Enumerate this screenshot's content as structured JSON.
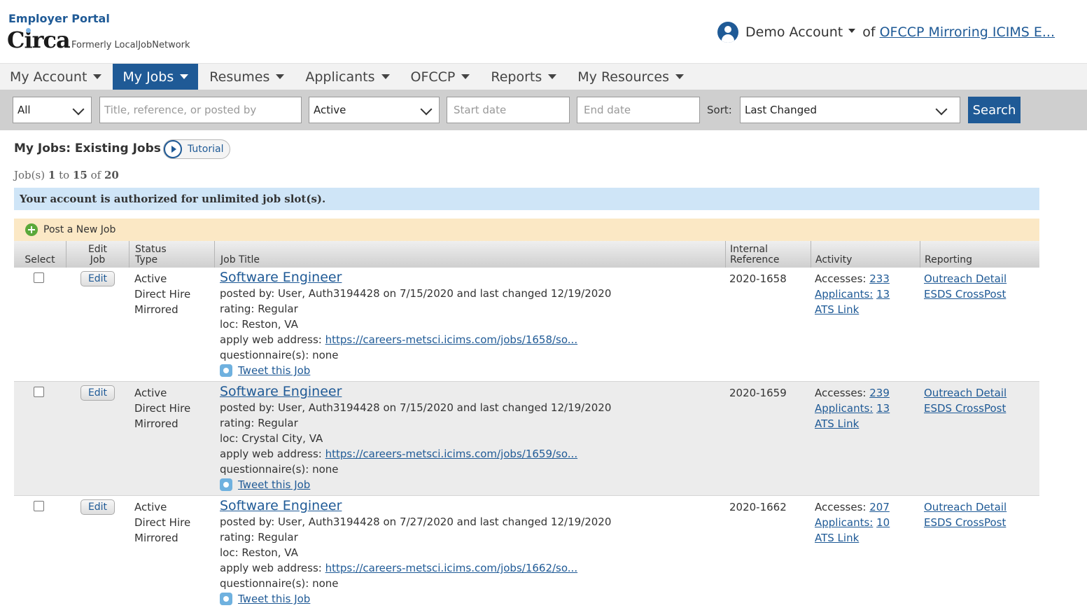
{
  "brand": {
    "portal_label": "Employer Portal",
    "logo_name": "Circa",
    "logo_subtitle": "Formerly LocalJobNetwork"
  },
  "account": {
    "name": "Demo Account",
    "of_label": "of",
    "org": "OFCCP Mirroring ICIMS E..."
  },
  "nav": [
    {
      "label": "My Account",
      "active": false
    },
    {
      "label": "My Jobs",
      "active": true
    },
    {
      "label": "Resumes",
      "active": false
    },
    {
      "label": "Applicants",
      "active": false
    },
    {
      "label": "OFCCP",
      "active": false
    },
    {
      "label": "Reports",
      "active": false
    },
    {
      "label": "My Resources",
      "active": false
    }
  ],
  "filters": {
    "category_value": "All",
    "keyword_placeholder": "Title, reference, or posted by",
    "status_value": "Active",
    "start_placeholder": "Start date",
    "end_placeholder": "End date",
    "sort_label": "Sort:",
    "sort_value": "Last Changed",
    "search_label": "Search"
  },
  "page": {
    "heading": "My Jobs: Existing Jobs",
    "tutorial_label": "Tutorial",
    "count_prefix": "Job(s)",
    "count_from": "1",
    "count_to_word": "to",
    "count_to": "15",
    "count_of_word": "of",
    "count_total": "20",
    "notice": "Your account is authorized for unlimited job slot(s).",
    "post_new_job": "Post a New Job"
  },
  "table": {
    "headers": {
      "select": "Select",
      "edit_line1": "Edit",
      "edit_line2": "Job",
      "status_line1": "Status",
      "status_line2": "Type",
      "title": "Job Title",
      "ref_line1": "Internal",
      "ref_line2": "Reference",
      "activity": "Activity",
      "reporting": "Reporting"
    },
    "rows": [
      {
        "edit": "Edit",
        "status": "Active",
        "type": "Direct Hire",
        "mirror": "Mirrored",
        "title": "Software Engineer",
        "posted": "posted by: User, Auth3194428 on 7/15/2020 and last changed 12/19/2020",
        "rating": "rating: Regular",
        "loc": "loc: Reston, VA",
        "apply_label": "apply web address:",
        "apply_url": "https://careers-metsci.icims.com/jobs/1658/so...",
        "questionnaire": "questionnaire(s): none",
        "tweet": "Tweet this Job",
        "ref": "2020-1658",
        "accesses_label": "Accesses:",
        "accesses": "233",
        "applicants_label": "Applicants:",
        "applicants": "13",
        "ats": "ATS Link",
        "outreach": "Outreach Detail",
        "esds": "ESDS CrossPost"
      },
      {
        "edit": "Edit",
        "status": "Active",
        "type": "Direct Hire",
        "mirror": "Mirrored",
        "title": "Software Engineer",
        "posted": "posted by: User, Auth3194428 on 7/15/2020 and last changed 12/19/2020",
        "rating": "rating: Regular",
        "loc": "loc: Crystal City, VA",
        "apply_label": "apply web address:",
        "apply_url": "https://careers-metsci.icims.com/jobs/1659/so...",
        "questionnaire": "questionnaire(s): none",
        "tweet": "Tweet this Job",
        "ref": "2020-1659",
        "accesses_label": "Accesses:",
        "accesses": "239",
        "applicants_label": "Applicants:",
        "applicants": "13",
        "ats": "ATS Link",
        "outreach": "Outreach Detail",
        "esds": "ESDS CrossPost"
      },
      {
        "edit": "Edit",
        "status": "Active",
        "type": "Direct Hire",
        "mirror": "Mirrored",
        "title": "Software Engineer",
        "posted": "posted by: User, Auth3194428 on 7/27/2020 and last changed 12/19/2020",
        "rating": "rating: Regular",
        "loc": "loc: Reston, VA",
        "apply_label": "apply web address:",
        "apply_url": "https://careers-metsci.icims.com/jobs/1662/so...",
        "questionnaire": "questionnaire(s): none",
        "tweet": "Tweet this Job",
        "ref": "2020-1662",
        "accesses_label": "Accesses:",
        "accesses": "207",
        "applicants_label": "Applicants:",
        "applicants": "10",
        "ats": "ATS Link",
        "outreach": "Outreach Detail",
        "esds": "ESDS CrossPost"
      }
    ]
  }
}
